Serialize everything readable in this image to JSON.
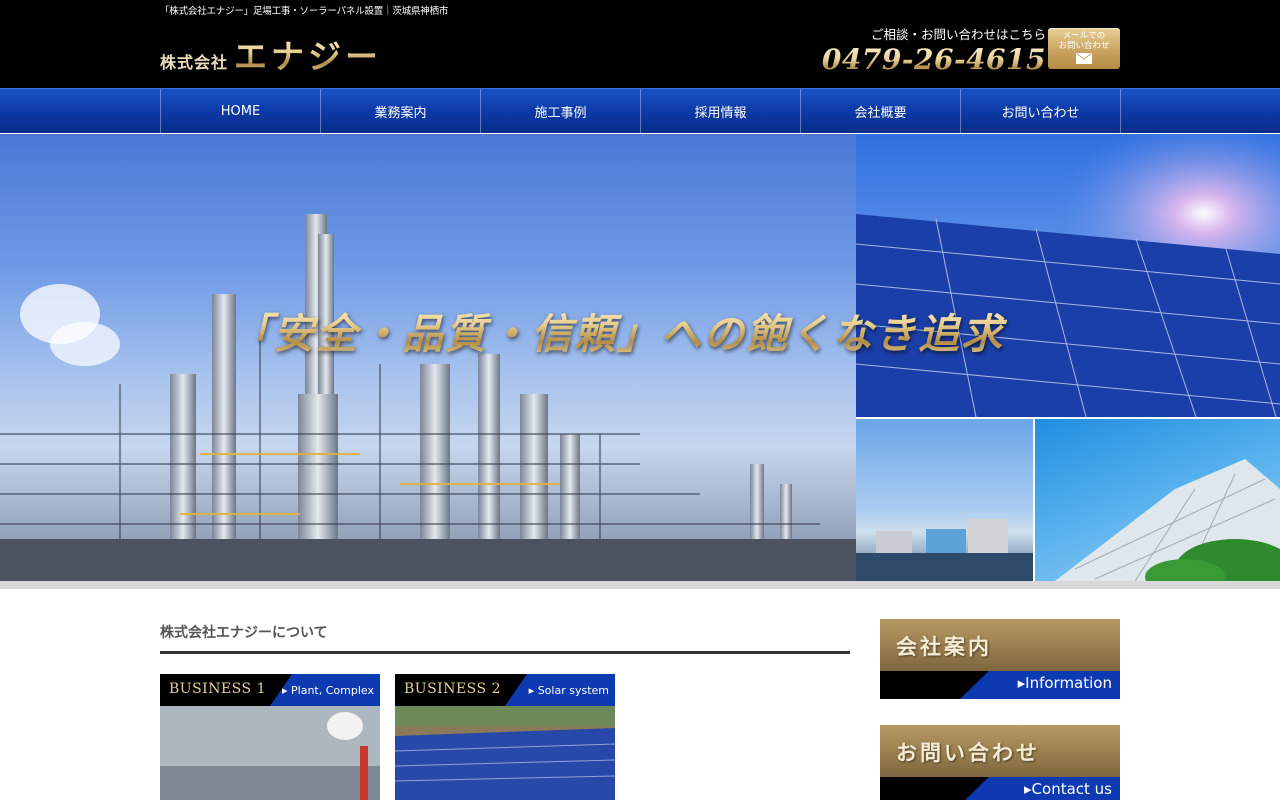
{
  "header": {
    "tagline": "「株式会社エナジー」足場工事・ソーラーパネル設置｜茨城県神栖市",
    "logo_prefix": "株式会社",
    "logo_name": "エナジー",
    "contact_label": "ご相談・お問い合わせはこちら",
    "phone": "0479-26-4615",
    "mail_button": "メールでの\nお問い合わせ"
  },
  "nav": {
    "items": [
      {
        "label": "HOME"
      },
      {
        "label": "業務案内"
      },
      {
        "label": "施工事例"
      },
      {
        "label": "採用情報"
      },
      {
        "label": "会社概要"
      },
      {
        "label": "お問い合わせ"
      }
    ]
  },
  "hero": {
    "headline": "「安全・品質・信頼」への飽くなき追求"
  },
  "main": {
    "section_title": "株式会社エナジーについて",
    "cards": [
      {
        "label": "BUSINESS 1",
        "tag": "Plant, Complex"
      },
      {
        "label": "BUSINESS 2",
        "tag": "Solar system"
      }
    ]
  },
  "sidebar": {
    "buttons": [
      {
        "title": "会社案内",
        "subtitle": "Information"
      },
      {
        "title": "お問い合わせ",
        "subtitle": "Contact us"
      }
    ]
  },
  "colors": {
    "nav_blue": "#0d3aa6",
    "gold": "#e6cf99",
    "header_bg": "#000000"
  },
  "icons": [
    "phone-icon",
    "mail-icon"
  ]
}
